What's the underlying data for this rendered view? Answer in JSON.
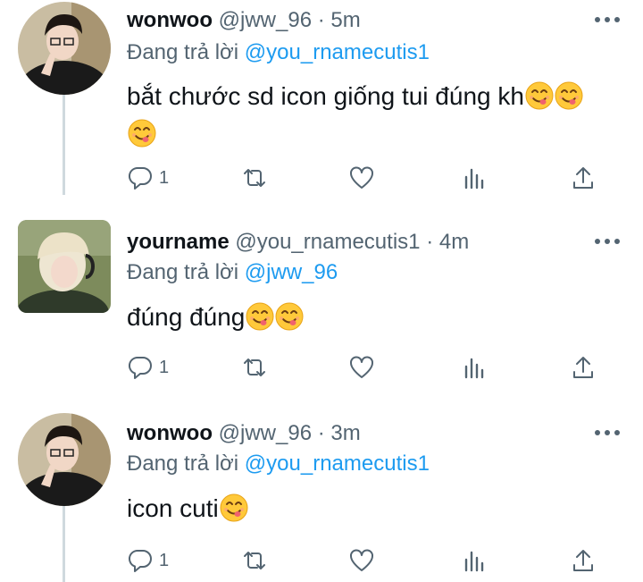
{
  "tweets": [
    {
      "name": "wonwoo",
      "handle": "@jww_96",
      "sep": "·",
      "time": "5m",
      "reply_prefix": "Đang trả lời",
      "reply_to": "@you_rnamecutis1",
      "text": "bắt chước sd icon giống tui đúng kh",
      "reply_count": "1"
    },
    {
      "name": "yourname",
      "handle": "@you_rnamecutis1",
      "sep": "·",
      "time": "4m",
      "reply_prefix": "Đang trả lời",
      "reply_to": "@jww_96",
      "text": "đúng đúng",
      "reply_count": "1"
    },
    {
      "name": "wonwoo",
      "handle": "@jww_96",
      "sep": "·",
      "time": "3m",
      "reply_prefix": "Đang trả lời",
      "reply_to": "@you_rnamecutis1",
      "text": "icon cuti",
      "reply_count": "1"
    }
  ],
  "colors": {
    "accent": "#1d9bf0",
    "secondary_text": "#536471",
    "thread_line": "#cfd9de"
  },
  "icons": [
    "more-icon",
    "reply-icon",
    "retweet-icon",
    "like-icon",
    "analytics-icon",
    "share-icon",
    "yum-emoji"
  ]
}
